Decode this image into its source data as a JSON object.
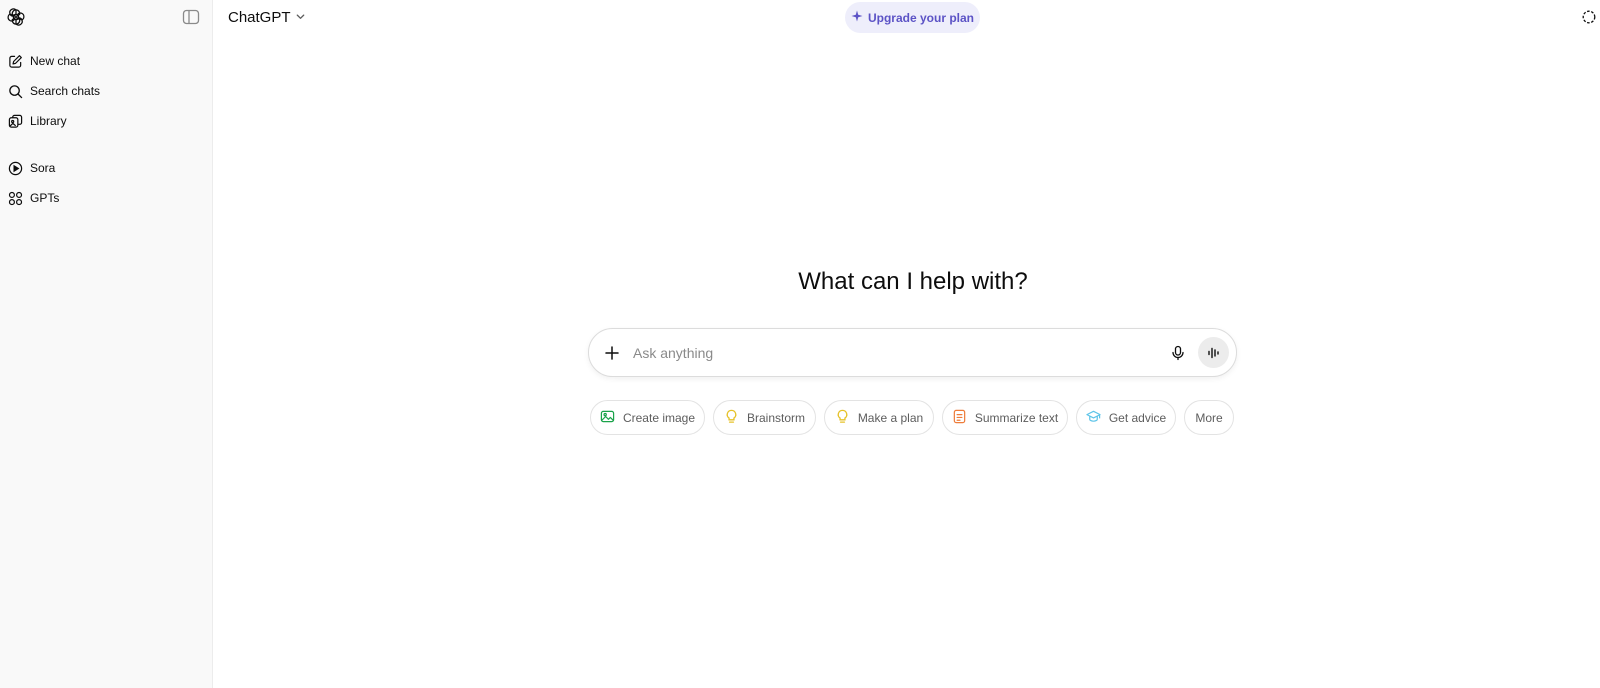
{
  "sidebar": {
    "logo_icon": "openai-logo-icon",
    "toggle_icon": "sidebar-toggle-icon",
    "items": [
      {
        "label": "New chat",
        "icon": "compose-icon"
      },
      {
        "label": "Search chats",
        "icon": "search-icon"
      },
      {
        "label": "Library",
        "icon": "library-icon"
      },
      {
        "label": "Sora",
        "icon": "play-circle-icon"
      },
      {
        "label": "GPTs",
        "icon": "grid-icon"
      }
    ]
  },
  "header": {
    "title": "ChatGPT",
    "upgrade_label": "Upgrade your plan",
    "accent_color": "#5c53c6"
  },
  "main": {
    "heading": "What can I help with?",
    "composer": {
      "placeholder": "Ask anything",
      "value": ""
    },
    "suggestions": [
      {
        "label": "Create image",
        "icon": "image-icon",
        "color": "#1aa34a"
      },
      {
        "label": "Brainstorm",
        "icon": "lightbulb-icon",
        "color": "#e6c229"
      },
      {
        "label": "Make a plan",
        "icon": "lightbulb-icon",
        "color": "#e6c229"
      },
      {
        "label": "Summarize text",
        "icon": "document-icon",
        "color": "#ee7d3b"
      },
      {
        "label": "Get advice",
        "icon": "graduation-cap-icon",
        "color": "#5ec4e8"
      },
      {
        "label": "More",
        "icon": "",
        "color": ""
      }
    ]
  }
}
